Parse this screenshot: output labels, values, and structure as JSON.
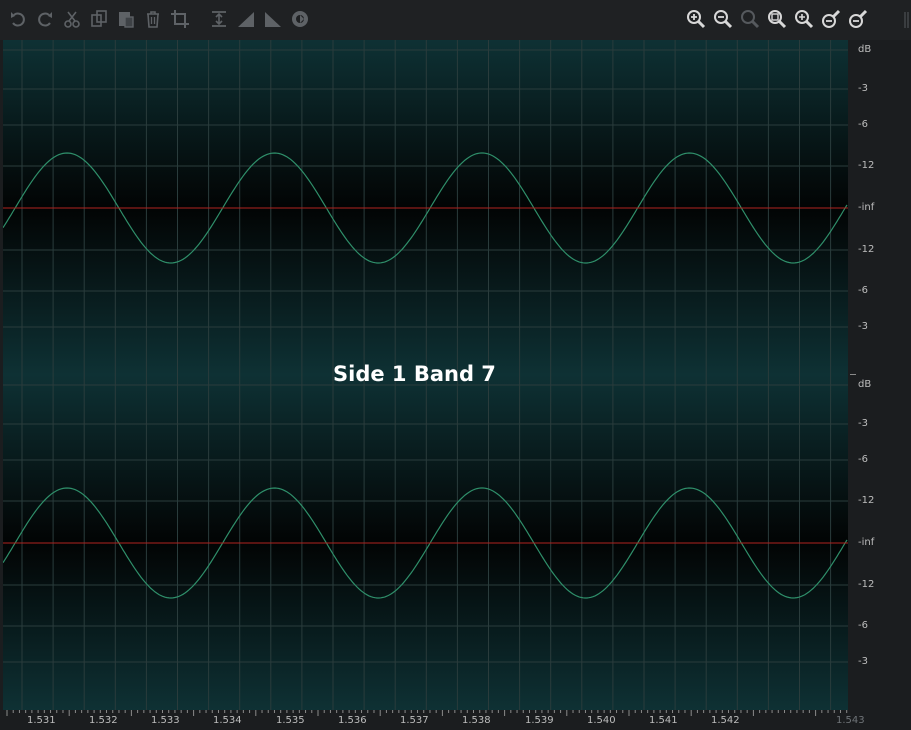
{
  "overlay": {
    "title": "Side 1 Band 7"
  },
  "toolbar": {
    "left": [
      {
        "icon": "undo-icon"
      },
      {
        "icon": "redo-icon"
      },
      {
        "icon": "cut-icon"
      },
      {
        "icon": "copy-icon"
      },
      {
        "icon": "paste-icon"
      },
      {
        "icon": "delete-icon"
      },
      {
        "icon": "crop-icon"
      },
      {
        "icon": "normalize-icon"
      },
      {
        "icon": "fade-in-icon"
      },
      {
        "icon": "fade-out-icon"
      },
      {
        "icon": "process-icon"
      }
    ],
    "right": [
      {
        "icon": "zoom-in-icon"
      },
      {
        "icon": "zoom-out-icon"
      },
      {
        "icon": "zoom-selection-icon"
      },
      {
        "icon": "zoom-full-icon"
      },
      {
        "icon": "zoom-in-vertical-icon"
      },
      {
        "icon": "zoom-out-vertical-icon"
      },
      {
        "icon": "zoom-reset-vertical-icon"
      }
    ]
  },
  "db_ruler": {
    "channel_1": [
      "dB",
      "-3",
      "-6",
      "-12",
      "-inf",
      "-12",
      "-6",
      "-3"
    ],
    "channel_2": [
      "dB",
      "-3",
      "-6",
      "-12",
      "-inf",
      "-12",
      "-6",
      "-3"
    ]
  },
  "time_ruler": {
    "ticks": [
      "1.531",
      "1.532",
      "1.533",
      "1.534",
      "1.535",
      "1.536",
      "1.537",
      "1.538",
      "1.539",
      "1.540",
      "1.541",
      "1.542",
      "1.543"
    ]
  },
  "colors": {
    "waveform": "#2f8f6a",
    "center_line": "#b0231f",
    "grid": "#2a3c3c",
    "background": "#031012"
  }
}
